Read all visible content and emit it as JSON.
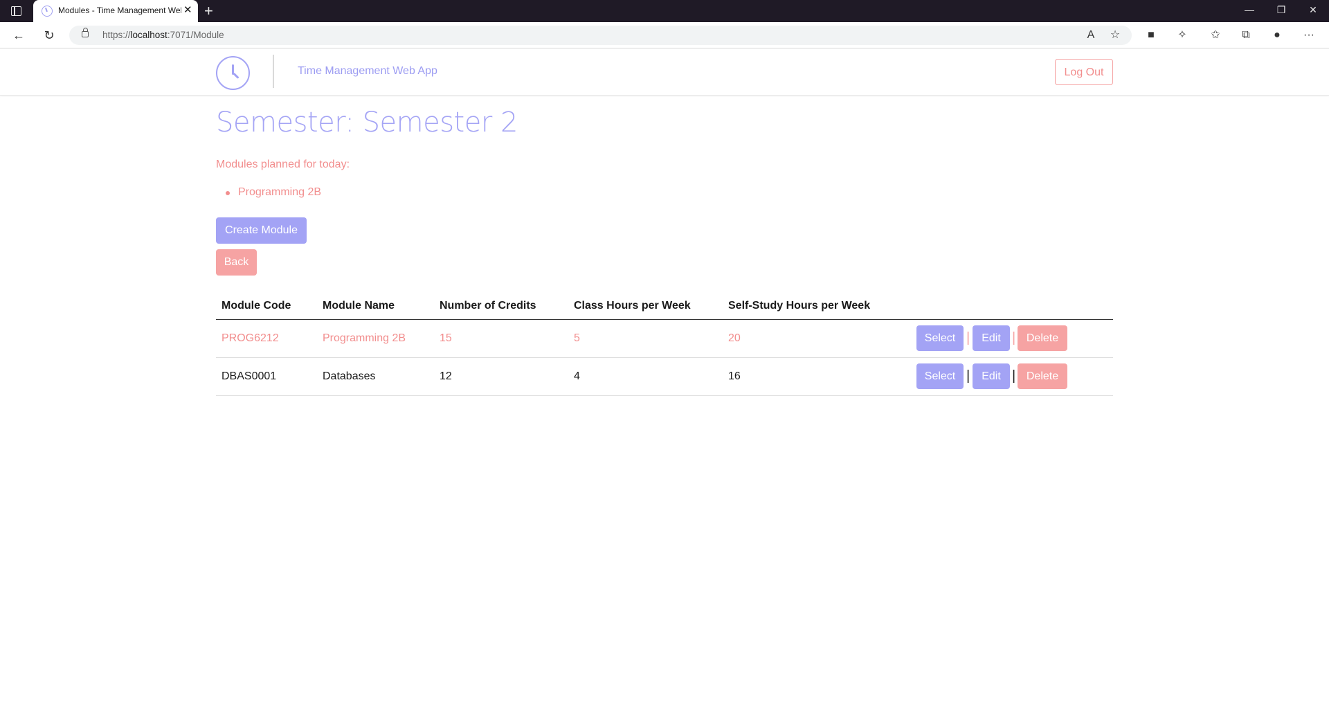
{
  "browser": {
    "tab_title": "Modules - Time Management Web App",
    "url_scheme": "https://",
    "url_host": "localhost",
    "url_rest": ":7071/Module"
  },
  "header": {
    "brand": "Time Management Web App",
    "logout_label": "Log Out"
  },
  "page": {
    "title": "Semester: Semester 2",
    "planned_label": "Modules planned for today:",
    "planned_modules": [
      "Programming 2B"
    ],
    "create_label": "Create Module",
    "back_label": "Back"
  },
  "table": {
    "headers": [
      "Module Code",
      "Module Name",
      "Number of Credits",
      "Class Hours per Week",
      "Self-Study Hours per Week"
    ],
    "rows": [
      {
        "code": "PROG6212",
        "name": "Programming 2B",
        "credits": "15",
        "class_hours": "5",
        "self_study": "20",
        "planned_today": true
      },
      {
        "code": "DBAS0001",
        "name": "Databases",
        "credits": "12",
        "class_hours": "4",
        "self_study": "16",
        "planned_today": false
      }
    ],
    "actions": {
      "select": "Select",
      "edit": "Edit",
      "delete": "Delete",
      "separator": "|"
    }
  },
  "colors": {
    "primary": "#a3a3f5",
    "danger": "#f6a3a3",
    "danger_text": "#f28e8e"
  }
}
